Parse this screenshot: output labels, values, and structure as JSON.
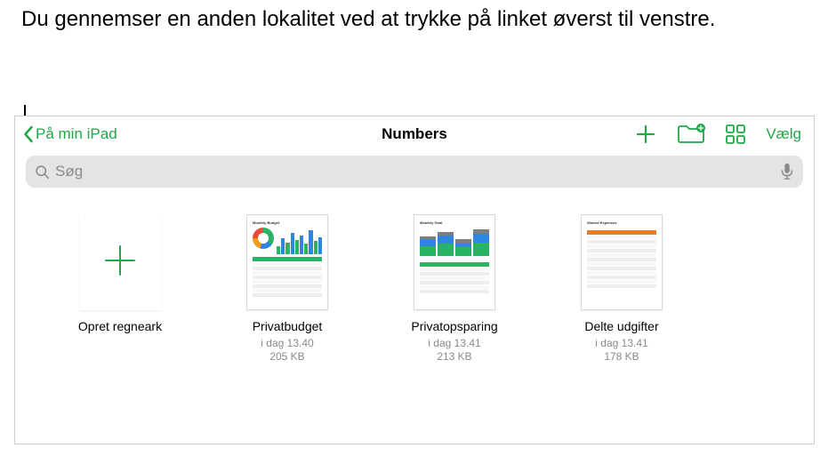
{
  "callout": {
    "text": "Du gennemser en anden lokalitet ved at trykke på linket øverst til venstre."
  },
  "nav": {
    "back_label": "På min iPad",
    "title": "Numbers",
    "select_label": "Vælg"
  },
  "search": {
    "placeholder": "Søg"
  },
  "create": {
    "label": "Opret regneark"
  },
  "files": [
    {
      "name": "Privatbudget",
      "date": "i dag 13.40",
      "size": "205 KB"
    },
    {
      "name": "Privatopsparing",
      "date": "i dag 13.41",
      "size": "213 KB"
    },
    {
      "name": "Delte udgifter",
      "date": "i dag 13.41",
      "size": "178 KB"
    }
  ],
  "colors": {
    "accent": "#1ea849"
  }
}
